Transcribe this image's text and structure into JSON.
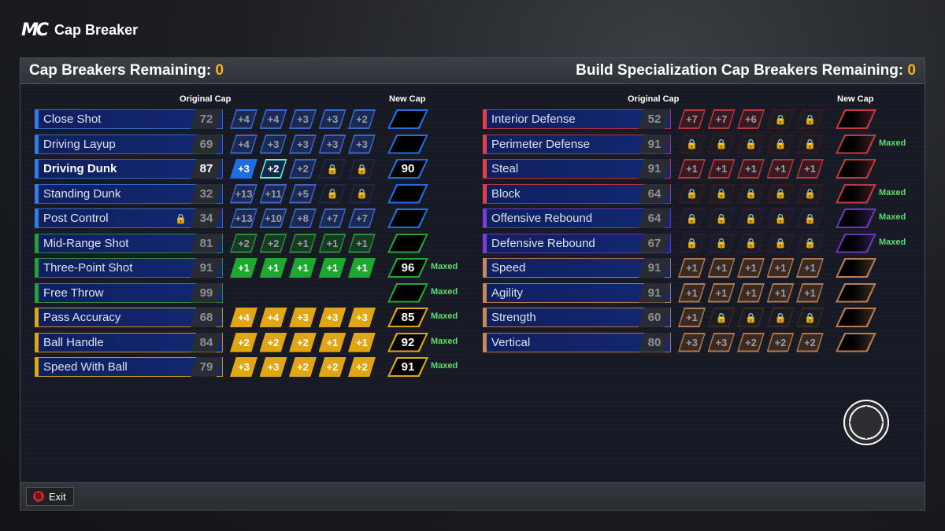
{
  "brand": {
    "logo": "MC",
    "title": "Cap Breaker"
  },
  "header": {
    "left_label": "Cap Breakers Remaining:",
    "left_value": "0",
    "right_label": "Build Specialization Cap Breakers Remaining:",
    "right_value": "0"
  },
  "columns": {
    "original_cap": "Original Cap",
    "new_cap": "New Cap"
  },
  "maxed_label": "Maxed",
  "footer": {
    "exit_key": "B",
    "exit_label": "Exit"
  },
  "colors": {
    "blue": "#2f7fe8",
    "green": "#22a33a",
    "gold": "#e0a618",
    "red": "#e0404a",
    "purple": "#7a3fd0",
    "tan": "#c68a5a",
    "maxed": "#5ddc6e",
    "accent": "#f2b31b"
  },
  "left_stats": [
    {
      "name": "Close Shot",
      "value": "72",
      "group": "blue",
      "boosts": [
        "+4",
        "+4",
        "+3",
        "+3",
        "+2"
      ],
      "boost_state": [
        "off",
        "off",
        "off",
        "off",
        "off"
      ],
      "new_cap": "",
      "maxed": false,
      "locked": false
    },
    {
      "name": "Driving Layup",
      "value": "69",
      "group": "blue",
      "boosts": [
        "+4",
        "+3",
        "+3",
        "+3",
        "+3"
      ],
      "boost_state": [
        "off",
        "off",
        "off",
        "off",
        "off"
      ],
      "new_cap": "",
      "maxed": false,
      "locked": false
    },
    {
      "name": "Driving Dunk",
      "value": "87",
      "group": "blue",
      "boosts": [
        "+3",
        "+2",
        "+2",
        "",
        ""
      ],
      "boost_state": [
        "on",
        "sel",
        "off",
        "lock",
        "lock"
      ],
      "new_cap": "90",
      "maxed": false,
      "locked": false,
      "selected": true
    },
    {
      "name": "Standing Dunk",
      "value": "32",
      "group": "blue",
      "boosts": [
        "+13",
        "+11",
        "+5",
        "",
        ""
      ],
      "boost_state": [
        "off",
        "off",
        "off",
        "lock",
        "lock"
      ],
      "new_cap": "",
      "maxed": false,
      "locked": false
    },
    {
      "name": "Post Control",
      "value": "34",
      "group": "blue",
      "boosts": [
        "+13",
        "+10",
        "+8",
        "+7",
        "+7"
      ],
      "boost_state": [
        "off",
        "off",
        "off",
        "off",
        "off"
      ],
      "new_cap": "",
      "maxed": false,
      "locked": true
    },
    {
      "name": "Mid-Range Shot",
      "value": "81",
      "group": "green",
      "boosts": [
        "+2",
        "+2",
        "+1",
        "+1",
        "+1"
      ],
      "boost_state": [
        "off",
        "off",
        "off",
        "off",
        "off"
      ],
      "new_cap": "",
      "maxed": false,
      "locked": false
    },
    {
      "name": "Three-Point Shot",
      "value": "91",
      "group": "green",
      "boosts": [
        "+1",
        "+1",
        "+1",
        "+1",
        "+1"
      ],
      "boost_state": [
        "on",
        "on",
        "on",
        "on",
        "on"
      ],
      "new_cap": "96",
      "maxed": true,
      "locked": false
    },
    {
      "name": "Free Throw",
      "value": "99",
      "group": "green",
      "boosts": [],
      "boost_state": [],
      "new_cap": "",
      "maxed": true,
      "locked": false
    },
    {
      "name": "Pass Accuracy",
      "value": "68",
      "group": "gold",
      "boosts": [
        "+4",
        "+4",
        "+3",
        "+3",
        "+3"
      ],
      "boost_state": [
        "on",
        "on",
        "on",
        "on",
        "on"
      ],
      "new_cap": "85",
      "maxed": true,
      "locked": false
    },
    {
      "name": "Ball Handle",
      "value": "84",
      "group": "gold",
      "boosts": [
        "+2",
        "+2",
        "+2",
        "+1",
        "+1"
      ],
      "boost_state": [
        "on",
        "on",
        "on",
        "on",
        "on"
      ],
      "new_cap": "92",
      "maxed": true,
      "locked": false
    },
    {
      "name": "Speed With Ball",
      "value": "79",
      "group": "gold",
      "boosts": [
        "+3",
        "+3",
        "+2",
        "+2",
        "+2"
      ],
      "boost_state": [
        "on",
        "on",
        "on",
        "on",
        "on"
      ],
      "new_cap": "91",
      "maxed": true,
      "locked": false
    }
  ],
  "right_stats": [
    {
      "name": "Interior Defense",
      "value": "52",
      "group": "red",
      "boosts": [
        "+7",
        "+7",
        "+6",
        "",
        ""
      ],
      "boost_state": [
        "off",
        "off",
        "off",
        "lock",
        "lock"
      ],
      "new_cap": "",
      "maxed": false
    },
    {
      "name": "Perimeter Defense",
      "value": "91",
      "group": "red",
      "boosts": [
        "",
        "",
        "",
        "",
        ""
      ],
      "boost_state": [
        "lock",
        "lock",
        "lock",
        "lock",
        "lock"
      ],
      "new_cap": "",
      "maxed": true
    },
    {
      "name": "Steal",
      "value": "91",
      "group": "red",
      "boosts": [
        "+1",
        "+1",
        "+1",
        "+1",
        "+1"
      ],
      "boost_state": [
        "off",
        "off",
        "off",
        "off",
        "off"
      ],
      "new_cap": "",
      "maxed": false
    },
    {
      "name": "Block",
      "value": "64",
      "group": "red",
      "boosts": [
        "",
        "",
        "",
        "",
        ""
      ],
      "boost_state": [
        "lock",
        "lock",
        "lock",
        "lock",
        "lock"
      ],
      "new_cap": "",
      "maxed": true
    },
    {
      "name": "Offensive Rebound",
      "value": "64",
      "group": "purple",
      "boosts": [
        "",
        "",
        "",
        "",
        ""
      ],
      "boost_state": [
        "lock",
        "lock",
        "lock",
        "lock",
        "lock"
      ],
      "new_cap": "",
      "maxed": true
    },
    {
      "name": "Defensive Rebound",
      "value": "67",
      "group": "purple",
      "boosts": [
        "",
        "",
        "",
        "",
        ""
      ],
      "boost_state": [
        "lock",
        "lock",
        "lock",
        "lock",
        "lock"
      ],
      "new_cap": "",
      "maxed": true
    },
    {
      "name": "Speed",
      "value": "91",
      "group": "tan",
      "boosts": [
        "+1",
        "+1",
        "+1",
        "+1",
        "+1"
      ],
      "boost_state": [
        "off",
        "off",
        "off",
        "off",
        "off"
      ],
      "new_cap": "",
      "maxed": false
    },
    {
      "name": "Agility",
      "value": "91",
      "group": "tan",
      "boosts": [
        "+1",
        "+1",
        "+1",
        "+1",
        "+1"
      ],
      "boost_state": [
        "off",
        "off",
        "off",
        "off",
        "off"
      ],
      "new_cap": "",
      "maxed": false
    },
    {
      "name": "Strength",
      "value": "60",
      "group": "tan",
      "boosts": [
        "+1",
        "",
        "",
        "",
        ""
      ],
      "boost_state": [
        "off",
        "lock",
        "lock",
        "lock",
        "lock"
      ],
      "new_cap": "",
      "maxed": false
    },
    {
      "name": "Vertical",
      "value": "80",
      "group": "tan",
      "boosts": [
        "+3",
        "+3",
        "+2",
        "+2",
        "+2"
      ],
      "boost_state": [
        "off",
        "off",
        "off",
        "off",
        "off"
      ],
      "new_cap": "",
      "maxed": false
    }
  ]
}
